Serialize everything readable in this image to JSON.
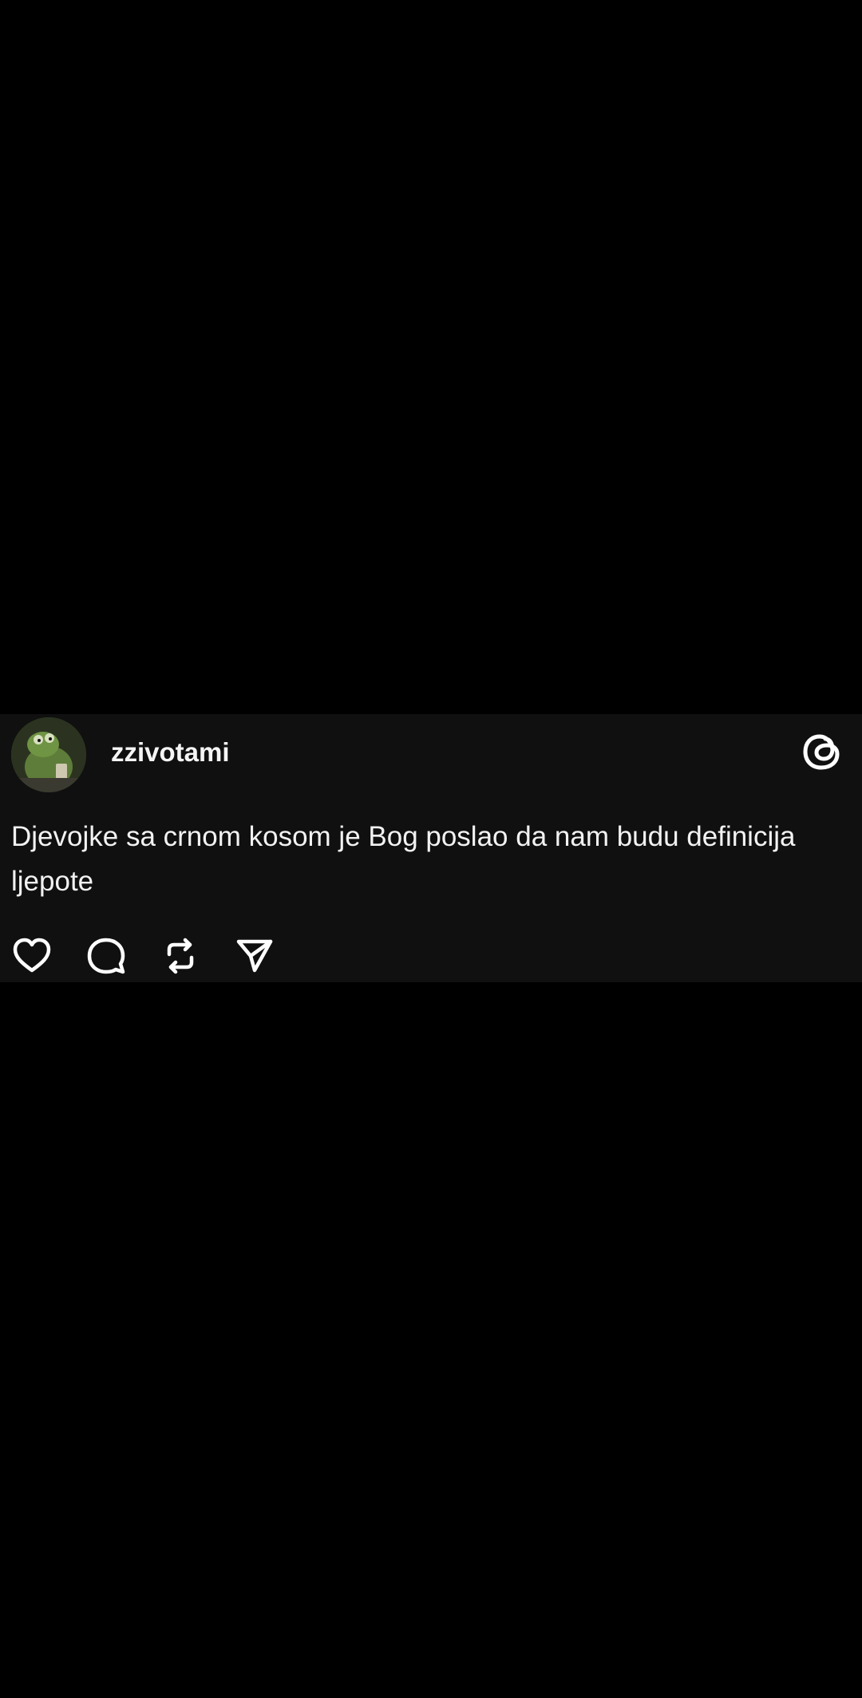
{
  "post": {
    "username": "zzivotami",
    "text": "Djevojke sa crnom kosom je Bog poslao da nam budu definicija ljepote",
    "avatar_icon": "kermit-avatar",
    "brand_icon": "threads-logo-icon"
  },
  "actions": [
    {
      "name": "like",
      "icon": "heart-icon"
    },
    {
      "name": "comment",
      "icon": "comment-bubble-icon"
    },
    {
      "name": "repost",
      "icon": "repost-icon"
    },
    {
      "name": "share",
      "icon": "send-icon"
    }
  ],
  "colors": {
    "background": "#000000",
    "card": "#101010",
    "text": "#f2f2f2"
  }
}
